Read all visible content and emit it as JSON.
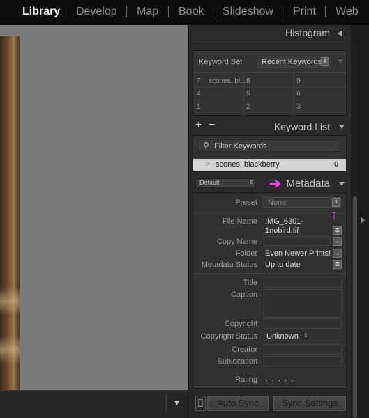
{
  "modules": [
    "Library",
    "Develop",
    "Map",
    "Book",
    "Slideshow",
    "Print",
    "Web"
  ],
  "active_module": "Library",
  "colors": {
    "accent_pink": "#ff3cf0",
    "panel_bg": "#2a2a2a",
    "active_module": "#f2f2f2"
  },
  "histogram": {
    "title": "Histogram"
  },
  "keywording": {
    "set_label": "Keyword Set",
    "set_value": "Recent Keywords",
    "grid": [
      [
        "7",
        "scones, bl...",
        "8",
        "9"
      ],
      [
        "4",
        "",
        "5",
        "6"
      ],
      [
        "1",
        "",
        "2",
        "3"
      ]
    ]
  },
  "keyword_list": {
    "plus": "+",
    "minus": "−",
    "title": "Keyword List",
    "filter_placeholder": "Filter Keywords",
    "items": [
      {
        "name": "scones, blackberry",
        "count": "0"
      }
    ]
  },
  "metadata": {
    "preset_select": "Default",
    "title": "Metadata",
    "preset_label": "Preset",
    "preset_value": "None",
    "fields": {
      "file_name_label": "File Name",
      "file_name_value_1": "IMG_6301-",
      "file_name_value_2": "1nobird.tif",
      "copy_name_label": "Copy Name",
      "folder_label": "Folder",
      "folder_value": "Even Newer Prints!",
      "metadata_status_label": "Metadata Status",
      "metadata_status_value": "Up to date",
      "title_label": "Title",
      "caption_label": "Caption",
      "copyright_label": "Copyright",
      "copyright_status_label": "Copyright Status",
      "copyright_status_value": "Unknown",
      "creator_label": "Creator",
      "sublocation_label": "Sublocation",
      "rating_label": "Rating",
      "rating_value": ". . . . ."
    }
  },
  "sync": {
    "auto_sync": "Auto Sync",
    "sync_settings": "Sync Settings"
  },
  "filmstrip": {
    "toggle": "▼"
  }
}
